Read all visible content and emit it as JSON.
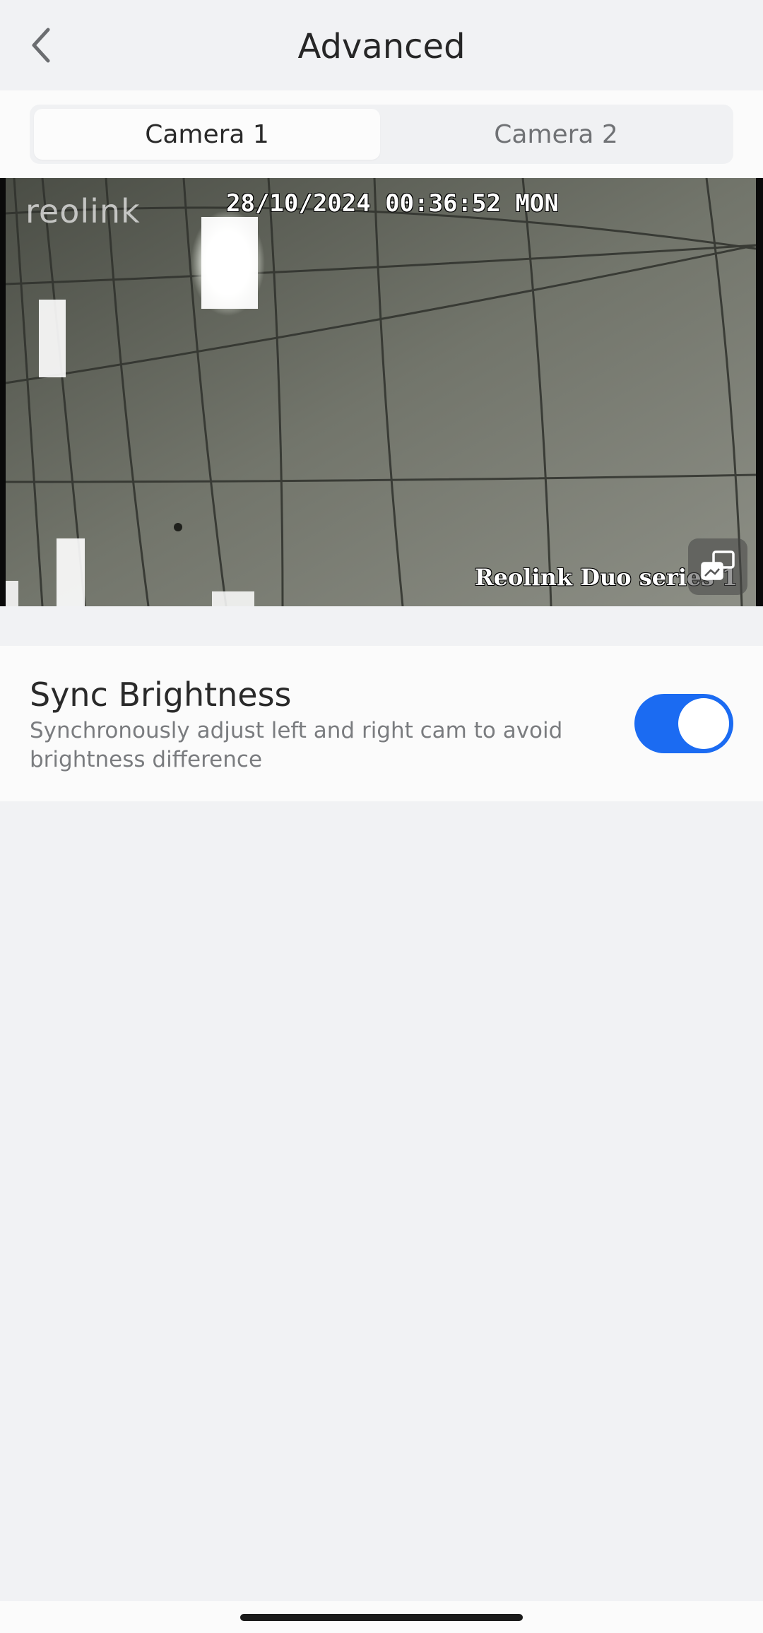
{
  "header": {
    "title": "Advanced",
    "back_icon": "chevron-left-icon"
  },
  "tabs": [
    {
      "label": "Camera 1",
      "selected": true
    },
    {
      "label": "Camera 2",
      "selected": false
    }
  ],
  "camera": {
    "watermark": "reolink",
    "timestamp": "28/10/2024 00:36:52 MON",
    "label": "Reolink Duo series 1",
    "switch_icon": "switch-view-icon"
  },
  "sync_brightness": {
    "title": "Sync Brightness",
    "description": "Synchronously adjust left and right cam to avoid brightness difference",
    "enabled": true
  },
  "colors": {
    "accent": "#1b6bf2",
    "background": "#f1f2f4",
    "card": "#fbfbfb"
  }
}
